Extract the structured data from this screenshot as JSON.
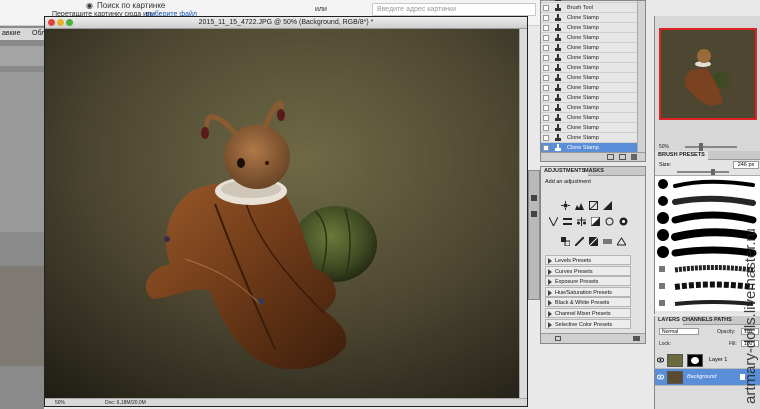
{
  "browser": {
    "search_title": "Поиск по картинке",
    "drag_hint": "Перетащите картинку сюда или",
    "choose_file": "выберите файл",
    "or_label": "или",
    "url_placeholder": "Введите адрес картинки",
    "left_tabs": [
      "авкие",
      "Обл"
    ]
  },
  "document": {
    "title": "2015_11_15_4722.JPG @ 50% (Background, RGB/8*) *",
    "zoom": "50%",
    "doc_info": "Doc: 6,18M/20,0M"
  },
  "history": {
    "items": [
      {
        "label": "Brush Tool",
        "active": false
      },
      {
        "label": "Brush Tool",
        "active": false
      },
      {
        "label": "Clone Stamp",
        "active": false
      },
      {
        "label": "Clone Stamp",
        "active": false
      },
      {
        "label": "Clone Stamp",
        "active": false
      },
      {
        "label": "Clone Stamp",
        "active": false
      },
      {
        "label": "Clone Stamp",
        "active": false
      },
      {
        "label": "Clone Stamp",
        "active": false
      },
      {
        "label": "Clone Stamp",
        "active": false
      },
      {
        "label": "Clone Stamp",
        "active": false
      },
      {
        "label": "Clone Stamp",
        "active": false
      },
      {
        "label": "Clone Stamp",
        "active": false
      },
      {
        "label": "Clone Stamp",
        "active": false
      },
      {
        "label": "Clone Stamp",
        "active": false
      },
      {
        "label": "Clone Stamp",
        "active": false
      },
      {
        "label": "Clone Stamp",
        "active": true
      }
    ]
  },
  "adjustments": {
    "tabs": [
      "ADJUSTMENTS",
      "MASKS"
    ],
    "heading": "Add an adjustment",
    "presets": [
      "Levels Presets",
      "Curves Presets",
      "Exposure Presets",
      "Hue/Saturation Presets",
      "Black & White Presets",
      "Channel Mixer Presets",
      "Selective Color Presets"
    ]
  },
  "navigator": {
    "zoom": "50%"
  },
  "brush_presets": {
    "tab": "BRUSH PRESETS",
    "size_label": "Size:",
    "size_value": "246 px"
  },
  "layers": {
    "tabs": [
      "LAYERS",
      "CHANNELS",
      "PATHS"
    ],
    "blend_mode": "Normal",
    "opacity_label": "Opacity:",
    "opacity_value": "100",
    "lock_label": "Lock:",
    "fill_label": "Fill:",
    "fill_value": "100",
    "items": [
      {
        "name": "Layer 1",
        "active": false
      },
      {
        "name": "Background",
        "active": true
      }
    ]
  },
  "watermark": "artmary-dolls.livemaster.ru",
  "colors": {
    "selection_blue": "#5a8ed8",
    "close_red": "#e0443e",
    "minimize_yellow": "#e9b129",
    "zoom_green": "#48b23a"
  }
}
